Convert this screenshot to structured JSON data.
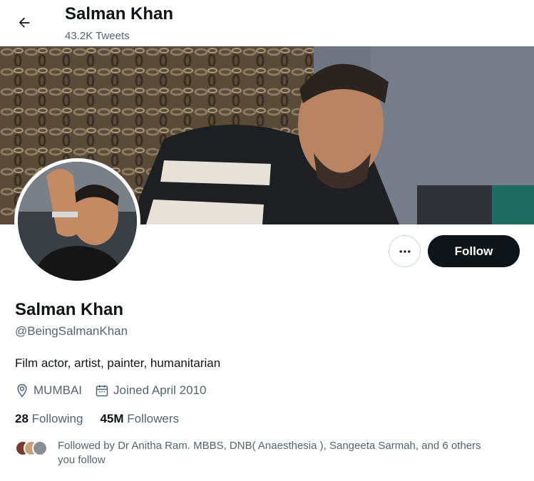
{
  "header": {
    "title": "Salman Khan",
    "tweet_count": "43.2K Tweets"
  },
  "profile": {
    "name": "Salman Khan",
    "handle": "@BeingSalmanKhan",
    "bio": "Film actor, artist, painter, humanitarian",
    "location": "MUMBAI",
    "joined": "Joined April 2010",
    "following_count": "28",
    "following_label": "Following",
    "followers_count": "45M",
    "followers_label": "Followers",
    "followed_by": "Followed by Dr Anitha Ram. MBBS, DNB( Anaesthesia ), Sangeeta Sarmah, and 6 others you follow"
  },
  "actions": {
    "follow_label": "Follow",
    "more_icon": "more-horizontal-icon"
  },
  "colors": {
    "text_primary": "#0f1419",
    "text_secondary": "#536471",
    "follow_bg": "#0f1419",
    "border": "#cfd9de"
  }
}
